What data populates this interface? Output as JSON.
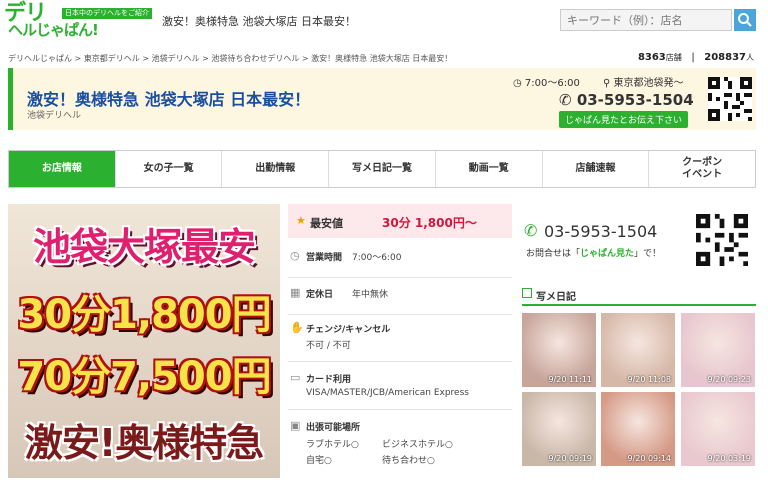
{
  "header": {
    "logo_main": "デリ",
    "logo_sub": "ヘルじゃぱん!",
    "logo_tag": "日本中のデリヘルをご紹介",
    "title": "激安！奥様特急 池袋大塚店 日本最安！",
    "search_placeholder": "キーワード（例）：店名"
  },
  "breadcrumb": {
    "text": "デリヘルじゃぱん  >  東京都デリヘル  >  池袋デリヘル  >  池袋待ち合わせデリヘル  >  激安！奥様特急 池袋大塚店 日本最安！"
  },
  "counts": {
    "shops": "8363",
    "shops_unit": "店舗",
    "separator": "|",
    "people": "208837",
    "people_unit": "人"
  },
  "shop": {
    "name": "激安！奥様特急 池袋大塚店 日本最安！",
    "genre": "池袋デリヘル",
    "hours": "7:00〜6:00",
    "area": "東京都池袋発〜",
    "phone": "03-5953-1504",
    "phone_note": "じゃぱん見たとお伝え下さい"
  },
  "tabs": [
    {
      "label": "お店情報",
      "active": true
    },
    {
      "label": "女の子一覧",
      "active": false
    },
    {
      "label": "出勤情報",
      "active": false
    },
    {
      "label": "写メ日記一覧",
      "active": false
    },
    {
      "label": "動画一覧",
      "active": false
    },
    {
      "label": "店舗速報",
      "active": false
    },
    {
      "label": "クーポン\nイベント",
      "active": false
    }
  ],
  "banner": {
    "line1": "池袋大塚最安",
    "line2": "30分1,800円",
    "line3": "70分7,500円",
    "line4": "激安!奥様特急"
  },
  "info": {
    "price_label": "最安値",
    "price_value": "30分  1,800円〜",
    "hours_label": "営業時間",
    "hours_value": "7:00〜6:00",
    "holiday_label": "定休日",
    "holiday_value": "年中無休",
    "change_label": "チェンジ/キャンセル",
    "change_value": "不可 / 不可",
    "card_label": "カード利用",
    "card_value": "VISA/MASTER/JCB/American Express",
    "places_label": "出張可能場所",
    "places": [
      "ラブホテル○",
      "ビジネスホテル○",
      "自宅○",
      "待ち合わせ○"
    ]
  },
  "contact": {
    "phone": "03-5953-1504",
    "note_prefix": "お問合せは「",
    "note_em": "じゃぱん見た",
    "note_suffix": "」で！"
  },
  "diary": {
    "title": "写メ日記",
    "thumbs": [
      {
        "time": "9/20 11:11",
        "color": "#c7a59a"
      },
      {
        "time": "9/20 11:08",
        "color": "#d6b8a8"
      },
      {
        "time": "9/20 09:23",
        "color": "#e7c6cf"
      },
      {
        "time": "9/20 09:19",
        "color": "#c9b7a8"
      },
      {
        "time": "9/20 09:14",
        "color": "#d59a86"
      },
      {
        "time": "9/20 03:19",
        "color": "#e9c9cf"
      }
    ]
  },
  "colors": {
    "brand": "#2bb12f",
    "title_blue": "#1a4fa0",
    "price_red": "#d2163c"
  },
  "icons": [
    "search-icon",
    "clock-icon",
    "pin-icon",
    "phone-icon",
    "star-icon",
    "calendar-icon",
    "hand-icon",
    "card-icon",
    "car-icon",
    "diary-icon"
  ]
}
